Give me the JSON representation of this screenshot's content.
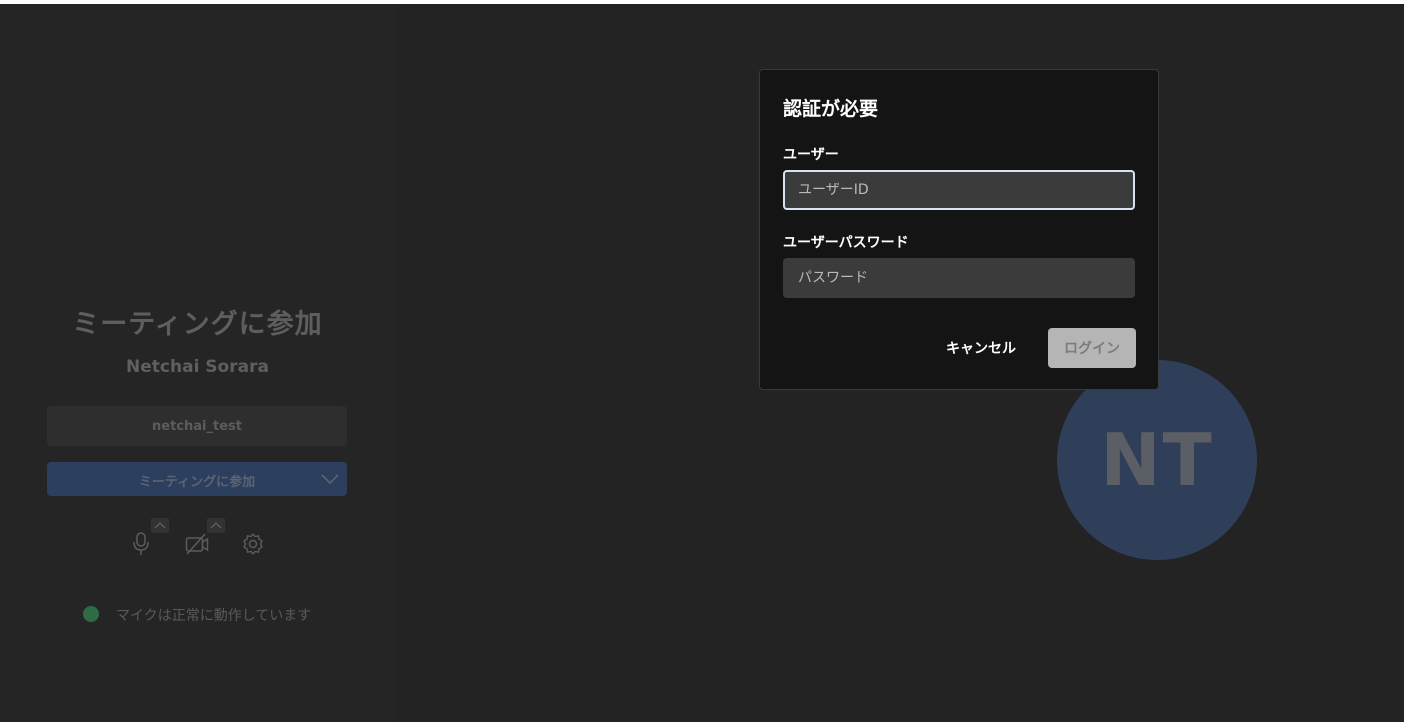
{
  "join_panel": {
    "title": "ミーティングに参加",
    "user_name": "Netchai Sorara",
    "meeting_id": "netchai_test",
    "join_button_label": "ミーティングに参加",
    "status_text": "マイクは正常に動作しています",
    "status_color": "#2f6b45"
  },
  "icons": {
    "mic": "microphone-icon",
    "camera_off": "camera-off-icon",
    "settings": "gear-icon",
    "caret": "chevron-up-icon",
    "dropdown": "chevron-down-icon"
  },
  "avatar": {
    "initials": "NT",
    "color": "#2f3e59"
  },
  "auth_dialog": {
    "title": "認証が必要",
    "user_label": "ユーザー",
    "user_placeholder": "ユーザーID",
    "user_value": "",
    "password_label": "ユーザーパスワード",
    "password_placeholder": "パスワード",
    "password_value": "",
    "cancel_label": "キャンセル",
    "login_label": "ログイン"
  }
}
